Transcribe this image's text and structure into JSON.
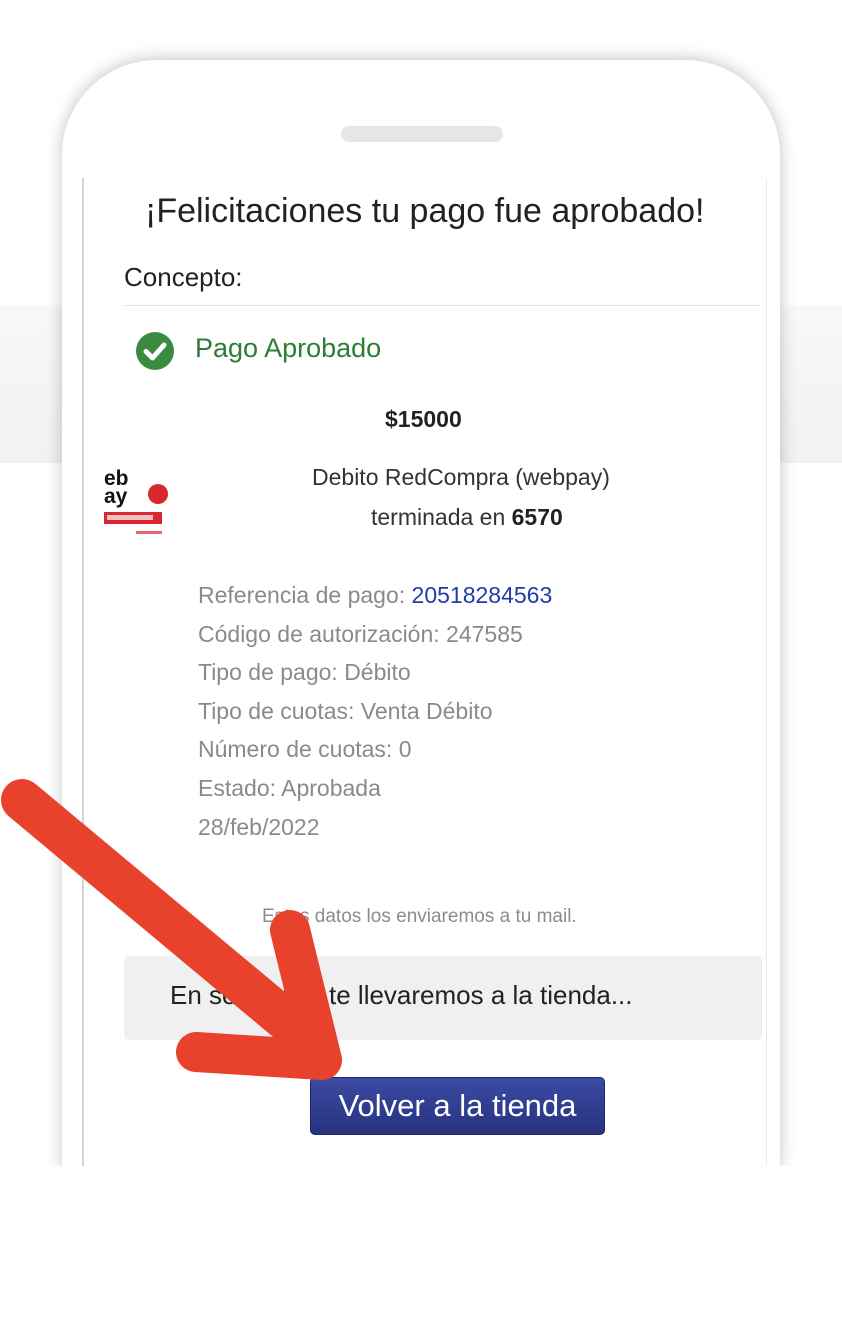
{
  "title": "¡Felicitaciones tu pago fue aprobado!",
  "concept_label": "Concepto:",
  "status_text": "Pago Aprobado",
  "amount": "$15000",
  "card": {
    "method": "Debito RedCompra (webpay)",
    "ending_label": "terminada en",
    "ending_digits": "6570"
  },
  "details": {
    "reference_label": "Referencia de pago:",
    "reference_value": "20518284563",
    "authorization": "Código de autorización: 247585",
    "payment_type": "Tipo de pago: Débito",
    "installment_type": "Tipo de cuotas: Venta Débito",
    "installments": "Número de cuotas: 0",
    "state": "Estado: Aprobada",
    "date": "28/feb/2022"
  },
  "mail_note": "Estos datos los enviaremos a tu mail.",
  "redirect_text": "En segundos te llevaremos a la tienda...",
  "store_button_label": "Volver a la tienda",
  "colors": {
    "success_green": "#2e7d32",
    "check_green": "#3a8a3f",
    "link_blue": "#1f3ca8",
    "button_blue": "#2f3c8f",
    "arrow_red": "#e8412c"
  }
}
